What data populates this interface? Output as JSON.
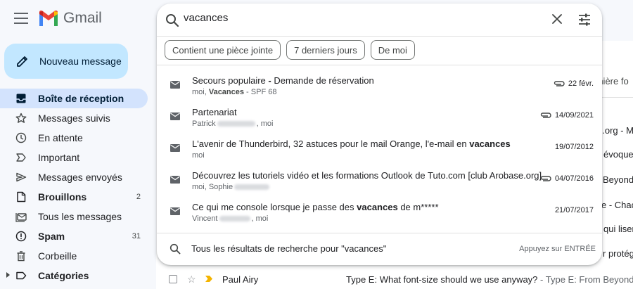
{
  "app": {
    "title": "Gmail",
    "compose_label": "Nouveau message"
  },
  "sidebar": {
    "items": [
      {
        "label": "Boîte de réception",
        "count": "",
        "icon": "inbox-icon"
      },
      {
        "label": "Messages suivis",
        "count": "",
        "icon": "star-icon"
      },
      {
        "label": "En attente",
        "count": "",
        "icon": "clock-icon"
      },
      {
        "label": "Important",
        "count": "",
        "icon": "important-icon"
      },
      {
        "label": "Messages envoyés",
        "count": "",
        "icon": "send-icon"
      },
      {
        "label": "Brouillons",
        "count": "2",
        "icon": "draft-icon"
      },
      {
        "label": "Tous les messages",
        "count": "",
        "icon": "all-mail-icon"
      },
      {
        "label": "Spam",
        "count": "31",
        "icon": "spam-icon"
      },
      {
        "label": "Corbeille",
        "count": "",
        "icon": "trash-icon"
      },
      {
        "label": "Catégories",
        "count": "",
        "icon": "label-icon"
      }
    ]
  },
  "search": {
    "query": "vacances",
    "chips": [
      "Contient une pièce jointe",
      "7 derniers jours",
      "De moi"
    ],
    "results": [
      {
        "title_pre": "Secours populaire ",
        "title_bold": "-",
        "title_post": " Demande de réservation",
        "sub_pre": "moi, ",
        "sub_bold": "Vacances",
        "sub_post": " - SPF 68",
        "date": "22 févr.",
        "attachment": true
      },
      {
        "title_pre": "Partenariat",
        "title_bold": "",
        "title_post": "",
        "sub_pre": "Patrick",
        "sub_bold": "",
        "sub_post": ", moi",
        "date": "14/09/2021",
        "attachment": true
      },
      {
        "title_pre": "L'avenir de Thunderbird, 32 astuces pour le mail Orange, l'e-mail en ",
        "title_bold": "vacances",
        "title_post": "",
        "sub_pre": "moi",
        "sub_bold": "",
        "sub_post": "",
        "date": "19/07/2012",
        "attachment": false
      },
      {
        "title_pre": "Découvrez les tutoriels vidéo et les formations Outlook de Tuto.com [club Arobase.org]",
        "title_bold": "",
        "title_post": "",
        "sub_pre": "moi, Sophie",
        "sub_bold": "",
        "sub_post": "",
        "date": "04/07/2016",
        "attachment": true
      },
      {
        "title_pre": "Ce qui me console lorsque je passe des ",
        "title_bold": "vacances",
        "title_post": " de m*****",
        "sub_pre": "Vincent",
        "sub_bold": "",
        "sub_post": ", moi",
        "date": "21/07/2017",
        "attachment": false
      }
    ],
    "all_results_label": "Tous les résultats de recherche pour \"vacances\"",
    "enter_hint": "Appuyez sur ENTRÉE"
  },
  "background": {
    "column_header": "rnière fo",
    "right_snippets": [
      "e.org - M",
      "évoque",
      "Beyond",
      "e - Chac",
      "qui liser",
      "r protég"
    ],
    "row": {
      "sender": "Paul Airy",
      "subject": "Type E: What font-size should we use anyway?",
      "snippet": " - Type E: From Beyond the"
    }
  },
  "colors": {
    "accent_blue": "#c2e7ff",
    "active_nav": "#d3e3fd",
    "gmail_red": "#ea4335"
  }
}
